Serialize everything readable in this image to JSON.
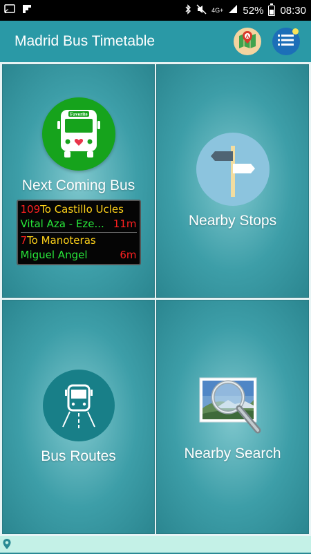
{
  "status_bar": {
    "network": "4G+",
    "battery": "52%",
    "time": "08:30"
  },
  "app_bar": {
    "title": "Madrid Bus Timetable",
    "icons": [
      "map-marker-icon",
      "list-menu-icon"
    ]
  },
  "tiles": {
    "next_bus": {
      "label": "Next Coming Bus",
      "icon_badge": "Favorite",
      "arrivals": [
        {
          "line": "109",
          "destination": "To Castillo Ucles",
          "stop": "Vital Aza - Eze...",
          "eta": "11m"
        },
        {
          "line": "7",
          "destination": "To Manoteras",
          "stop": "Miguel Angel",
          "eta": "6m"
        }
      ]
    },
    "nearby_stops": {
      "label": "Nearby Stops"
    },
    "bus_routes": {
      "label": "Bus Routes"
    },
    "nearby_search": {
      "label": "Nearby Search"
    }
  },
  "colors": {
    "app_bar": "#2a99a6",
    "tile": "#3d9ea8",
    "favorite_green": "#16a31c",
    "led_red": "#ff2020",
    "led_yellow": "#ffd21a",
    "led_green": "#28e83a"
  }
}
